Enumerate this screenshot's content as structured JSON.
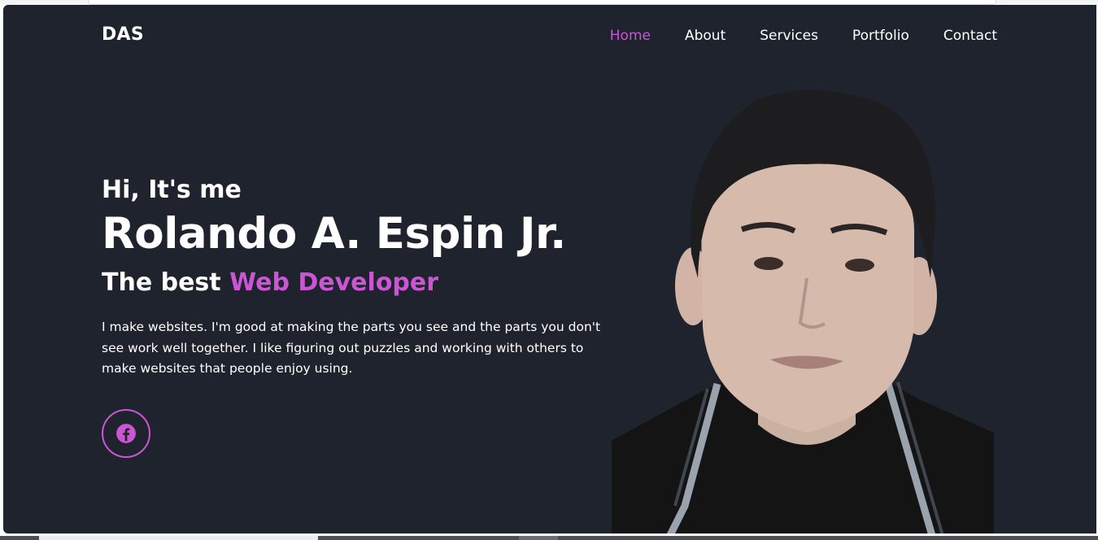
{
  "brand": {
    "logo": "DAS"
  },
  "nav": {
    "items": [
      "Home",
      "About",
      "Services",
      "Portfolio",
      "Contact"
    ],
    "active": "Home"
  },
  "hero": {
    "greeting": "Hi, It's me",
    "name": "Rolando A. Espin Jr.",
    "role_prefix": "The best",
    "role_highlight": "Web Developer",
    "bio": "I make websites. I'm good at making the parts you see and the parts you don't see work well together. I like figuring out puzzles and working with others to make websites that people enjoy using."
  },
  "social": {
    "icon": "facebook-icon"
  },
  "colors": {
    "background": "#1f232d",
    "accent": "#cc55d6",
    "text": "#ffffff"
  }
}
